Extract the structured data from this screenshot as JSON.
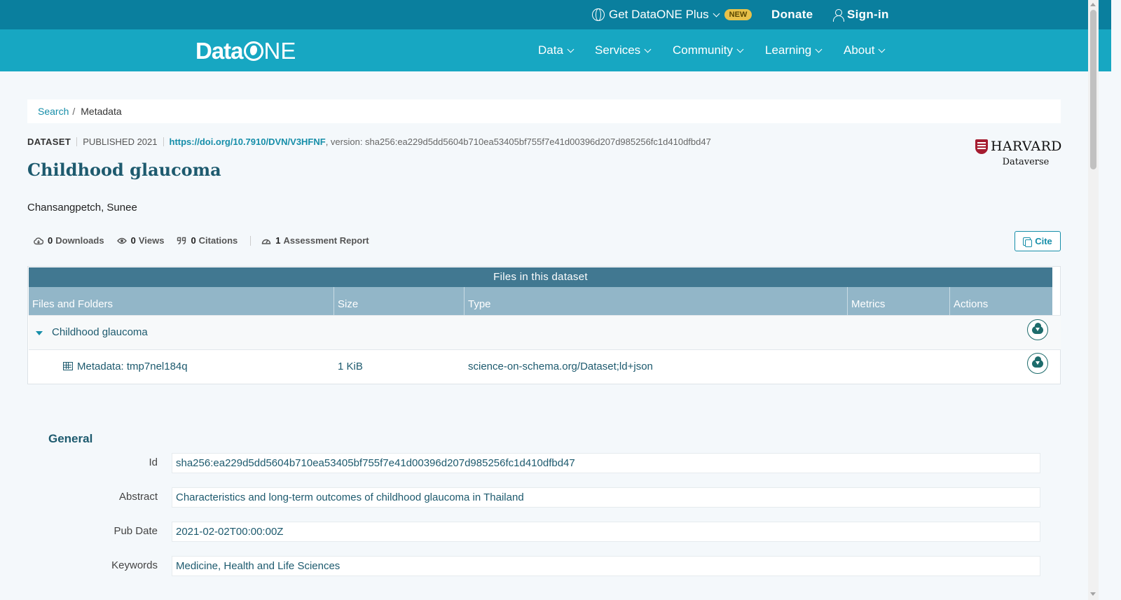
{
  "topbar": {
    "plus_label": "Get DataONE Plus",
    "new_badge": "NEW",
    "donate": "Donate",
    "signin": "Sign-in"
  },
  "nav": {
    "logo_data": "Data",
    "logo_ne": "NE",
    "items": [
      "Data",
      "Services",
      "Community",
      "Learning",
      "About"
    ]
  },
  "breadcrumb": {
    "search": "Search",
    "sep": "/",
    "current": "Metadata"
  },
  "dataset": {
    "type": "DATASET",
    "published": "PUBLISHED 2021",
    "doi": "https://doi.org/10.7910/DVN/V3HFNF",
    "version": ", version: sha256:ea229d5dd5604b710ea53405bf755f7e41d00396d207d985256fc1d410dfbd47",
    "title": "Childhood glaucoma",
    "author": "Chansangpetch, Sunee",
    "repository_line1": "HARVARD",
    "repository_line2": "Dataverse"
  },
  "stats": {
    "downloads_count": "0",
    "downloads_label": "Downloads",
    "views_count": "0",
    "views_label": "Views",
    "citations_count": "0",
    "citations_label": "Citations",
    "assessment_count": "1",
    "assessment_label": "Assessment Report",
    "cite_button": "Cite"
  },
  "files": {
    "caption": "Files in this dataset",
    "headers": [
      "Files and Folders",
      "Size",
      "Type",
      "Metrics",
      "Actions"
    ],
    "folder": "Childhood glaucoma",
    "rows": [
      {
        "name": "Metadata: tmp7nel184q",
        "size": "1 KiB",
        "type": "science-on-schema.org/Dataset;ld+json"
      }
    ]
  },
  "general": {
    "heading": "General",
    "fields": [
      {
        "label": "Id",
        "value": "sha256:ea229d5dd5604b710ea53405bf755f7e41d00396d207d985256fc1d410dfbd47"
      },
      {
        "label": "Abstract",
        "value": "Characteristics and long-term outcomes of childhood glaucoma in Thailand"
      },
      {
        "label": "Pub Date",
        "value": "2021-02-02T00:00:00Z"
      },
      {
        "label": "Keywords",
        "value": "Medicine, Health and Life Sciences"
      }
    ]
  },
  "icons": [
    "globe-icon",
    "chevron-down-icon",
    "user-icon",
    "cloud-download-icon",
    "eye-icon",
    "quote-icon",
    "gauge-icon",
    "copy-icon",
    "caret-down-icon",
    "table-icon"
  ],
  "colors": {
    "topbar": "#0a7f9e",
    "nav": "#17a7c2",
    "accent": "#168ea9",
    "table_caption": "#417891",
    "table_header": "#92b6c8",
    "heading": "#1d5a6e"
  }
}
